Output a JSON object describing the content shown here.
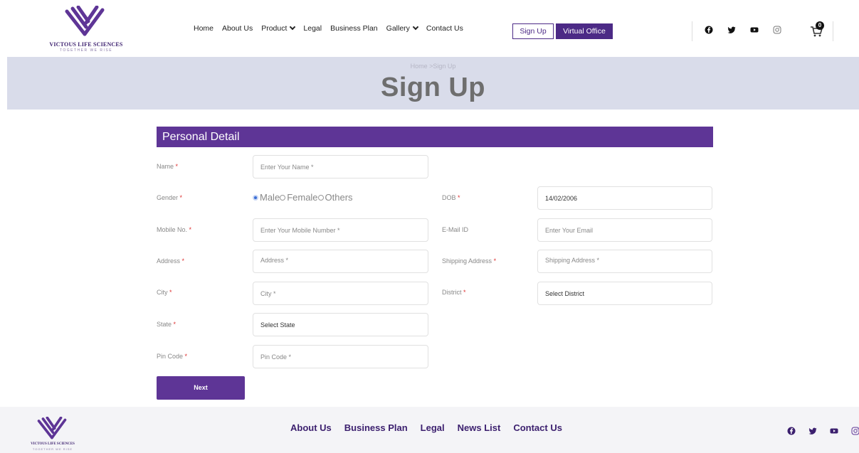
{
  "brand": {
    "name": "VICTOUS LIFE SCIENCES",
    "tagline": "TOGETHER WE RISE",
    "color": "#4c2a86"
  },
  "nav": {
    "items": [
      {
        "label": "Home",
        "dropdown": false
      },
      {
        "label": "About Us",
        "dropdown": false
      },
      {
        "label": "Product",
        "dropdown": true
      },
      {
        "label": "Legal",
        "dropdown": false
      },
      {
        "label": "Business Plan",
        "dropdown": false
      },
      {
        "label": "Gallery",
        "dropdown": true
      },
      {
        "label": "Contact Us",
        "dropdown": false
      }
    ],
    "signup_label": "Sign Up",
    "virtual_office_label": "Virtual Office"
  },
  "social": [
    "facebook-icon",
    "twitter-icon",
    "youtube-icon",
    "instagram-icon"
  ],
  "cart": {
    "count": "0"
  },
  "banner": {
    "breadcrumb": "Home >Sign Up",
    "title": "Sign Up"
  },
  "form": {
    "section_title": "Personal Detail",
    "name": {
      "label": "Name",
      "placeholder": "Enter Your Name *"
    },
    "gender": {
      "label": "Gender",
      "options": [
        "Male",
        "Female",
        "Others"
      ],
      "selected": "Male"
    },
    "dob": {
      "label": "DOB",
      "value": "14/02/2006"
    },
    "mobile": {
      "label": "Mobile No.",
      "placeholder": "Enter Your Mobile Number *"
    },
    "email": {
      "label": "E-Mail ID",
      "placeholder": "Enter Your Email"
    },
    "address": {
      "label": "Address",
      "placeholder": "Address *"
    },
    "shipping": {
      "label": "Shipping Address",
      "placeholder": "Shipping Address *"
    },
    "city": {
      "label": "City",
      "placeholder": "City *"
    },
    "district": {
      "label": "District",
      "value": "Select District"
    },
    "state": {
      "label": "State",
      "value": "Select State"
    },
    "pincode": {
      "label": "Pin Code",
      "placeholder": "Pin Code *"
    },
    "required_mark": "*",
    "next_label": "Next"
  },
  "footer": {
    "links": [
      "About Us",
      "Business Plan",
      "Legal",
      "News List",
      "Contact Us"
    ]
  },
  "colors": {
    "primary": "#5e3596",
    "banner_bg": "#d9dcea",
    "required": "#dd3333"
  }
}
